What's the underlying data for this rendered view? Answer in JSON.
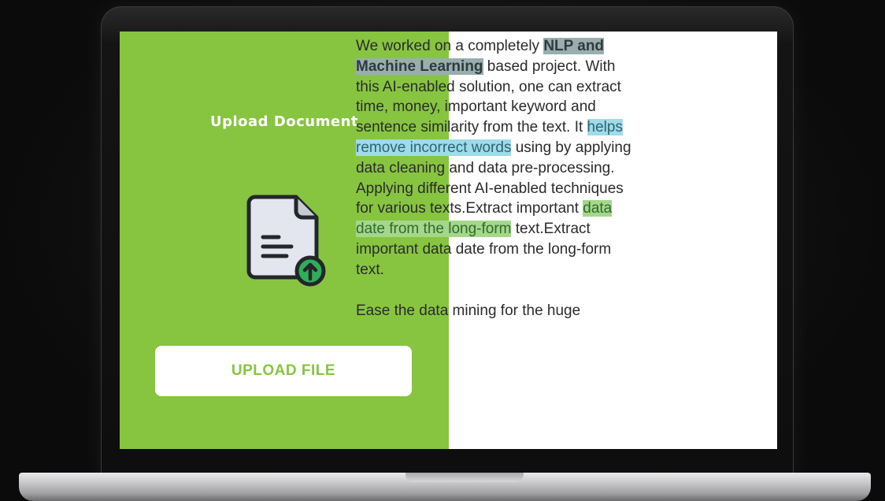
{
  "upload_panel": {
    "title": "Upload Document",
    "button_label": "UPLOAD FILE",
    "icon": "file-upload-icon",
    "background_color": "#87c540"
  },
  "content": {
    "paragraph1": {
      "part1": "We worked on a completely ",
      "highlight1": "NLP and Machine Learning",
      "part2": " based project. With this AI-enabled solution, one can extract time, money, important keyword and sentence similarity from the text. It ",
      "highlight2": "helps remove incorrect words",
      "part3": " using by applying data cleaning and data pre-processing. Applying different AI-enabled techniques for various texts.Extract important ",
      "highlight3": "data date from the long-form",
      "part4": " text.Extract important data date from the long-form text."
    },
    "paragraph2": "Ease the data mining for the huge"
  },
  "colors": {
    "highlight_dark": "#9aaeb0",
    "highlight_blue": "#9fdbe8",
    "highlight_green": "#a5d78a"
  }
}
